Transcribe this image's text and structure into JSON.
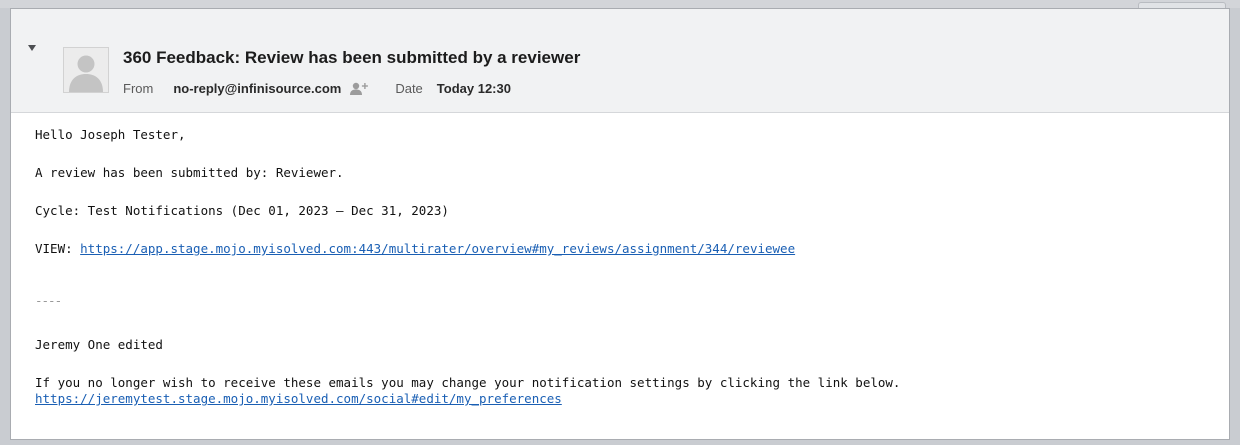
{
  "email": {
    "subject": "360 Feedback: Review has been submitted by a reviewer",
    "from_label": "From",
    "from_address": "no-reply@infinisource.com",
    "date_label": "Date",
    "date_value": "Today 12:30"
  },
  "body": {
    "greeting": "Hello Joseph Tester,",
    "line_submitted": "A review has been submitted by: Reviewer.",
    "line_cycle": "Cycle: Test Notifications (Dec 01, 2023 – Dec 31, 2023)",
    "view_label": "VIEW: ",
    "view_link": "https://app.stage.mojo.myisolved.com:443/multirater/overview#my_reviews/assignment/344/reviewee",
    "separator": "----",
    "signature": "Jeremy One edited",
    "footer_text": "If you no longer wish to receive these emails you may change your notification settings by clicking the link below.",
    "footer_link": "https://jeremytest.stage.mojo.myisolved.com/social#edit/my_preferences"
  },
  "icons": {
    "collapse": "disclosure-triangle-icon",
    "avatar": "person-silhouette-icon",
    "add_contact": "add-contact-icon"
  }
}
